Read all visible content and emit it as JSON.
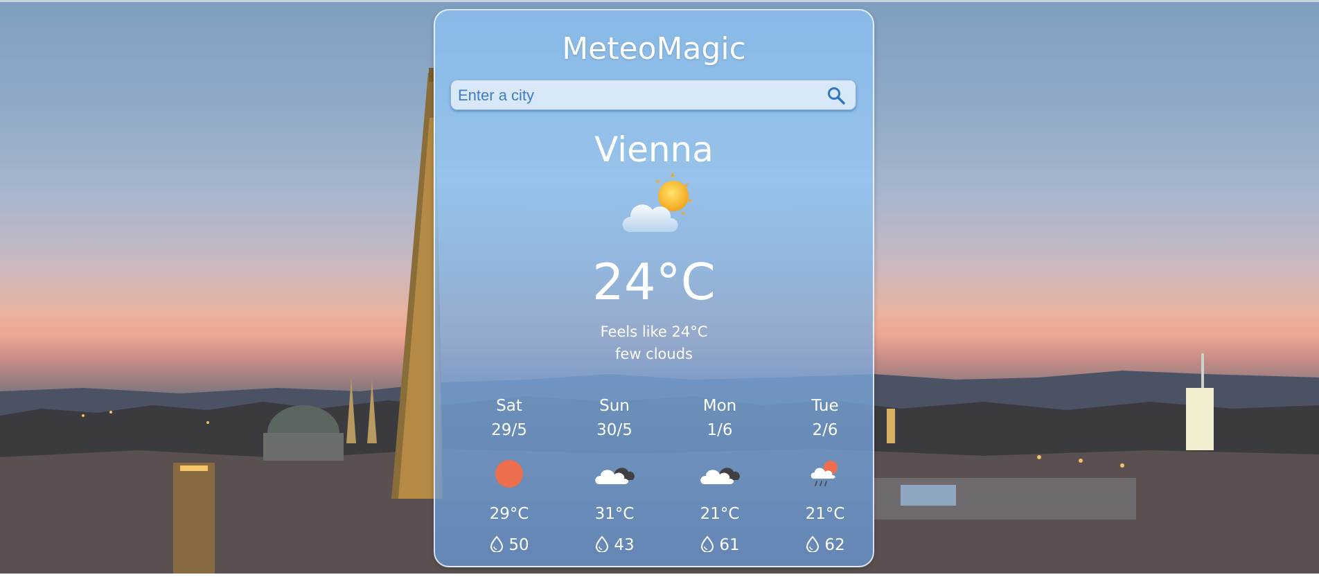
{
  "app": {
    "title": "MeteoMagic"
  },
  "search": {
    "placeholder": "Enter a city",
    "icon": "search-icon"
  },
  "current": {
    "city": "Vienna",
    "icon": "sun-behind-cloud-icon",
    "temperature": "24°C",
    "feels_like": "Feels like 24°C",
    "description": "few clouds"
  },
  "forecast": [
    {
      "day": "Sat",
      "date": "29/5",
      "icon": "sun-icon",
      "temp": "29°C",
      "humidity": "50"
    },
    {
      "day": "Sun",
      "date": "30/5",
      "icon": "cloudy-icon",
      "temp": "31°C",
      "humidity": "43"
    },
    {
      "day": "Mon",
      "date": "1/6",
      "icon": "cloudy-icon",
      "temp": "21°C",
      "humidity": "61"
    },
    {
      "day": "Tue",
      "date": "2/6",
      "icon": "rain-sun-cloud-icon",
      "temp": "21°C",
      "humidity": "62"
    }
  ],
  "colors": {
    "accent_text": "#3d7cc2",
    "sun_dot": "#ec6e4c",
    "card_bg": "#88bae8"
  }
}
